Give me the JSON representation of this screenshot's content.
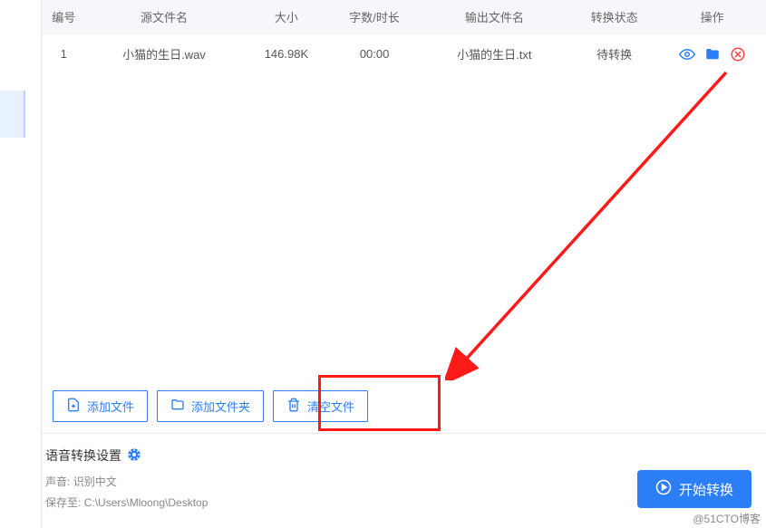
{
  "table": {
    "headers": {
      "id": "编号",
      "source": "源文件名",
      "size": "大小",
      "duration": "字数/时长",
      "output": "输出文件名",
      "status": "转换状态",
      "ops": "操作"
    },
    "rows": [
      {
        "id": "1",
        "source": "小猫的生日.wav",
        "size": "146.98K",
        "duration": "00:00",
        "output": "小猫的生日.txt",
        "status": "待转换"
      }
    ]
  },
  "actions": {
    "add_file": "添加文件",
    "add_folder": "添加文件夹",
    "clear_files": "清空文件"
  },
  "settings": {
    "title": "语音转换设置",
    "voice_label": "声音:",
    "voice_value": "识别中文",
    "save_label": "保存至:",
    "save_path": "C:\\Users\\Mloong\\Desktop"
  },
  "start_button": "开始转换",
  "watermark": "@51CTO博客",
  "colors": {
    "primary": "#2c7ef8",
    "danger": "#ff1a1a",
    "folder": "#2c7ef8"
  }
}
